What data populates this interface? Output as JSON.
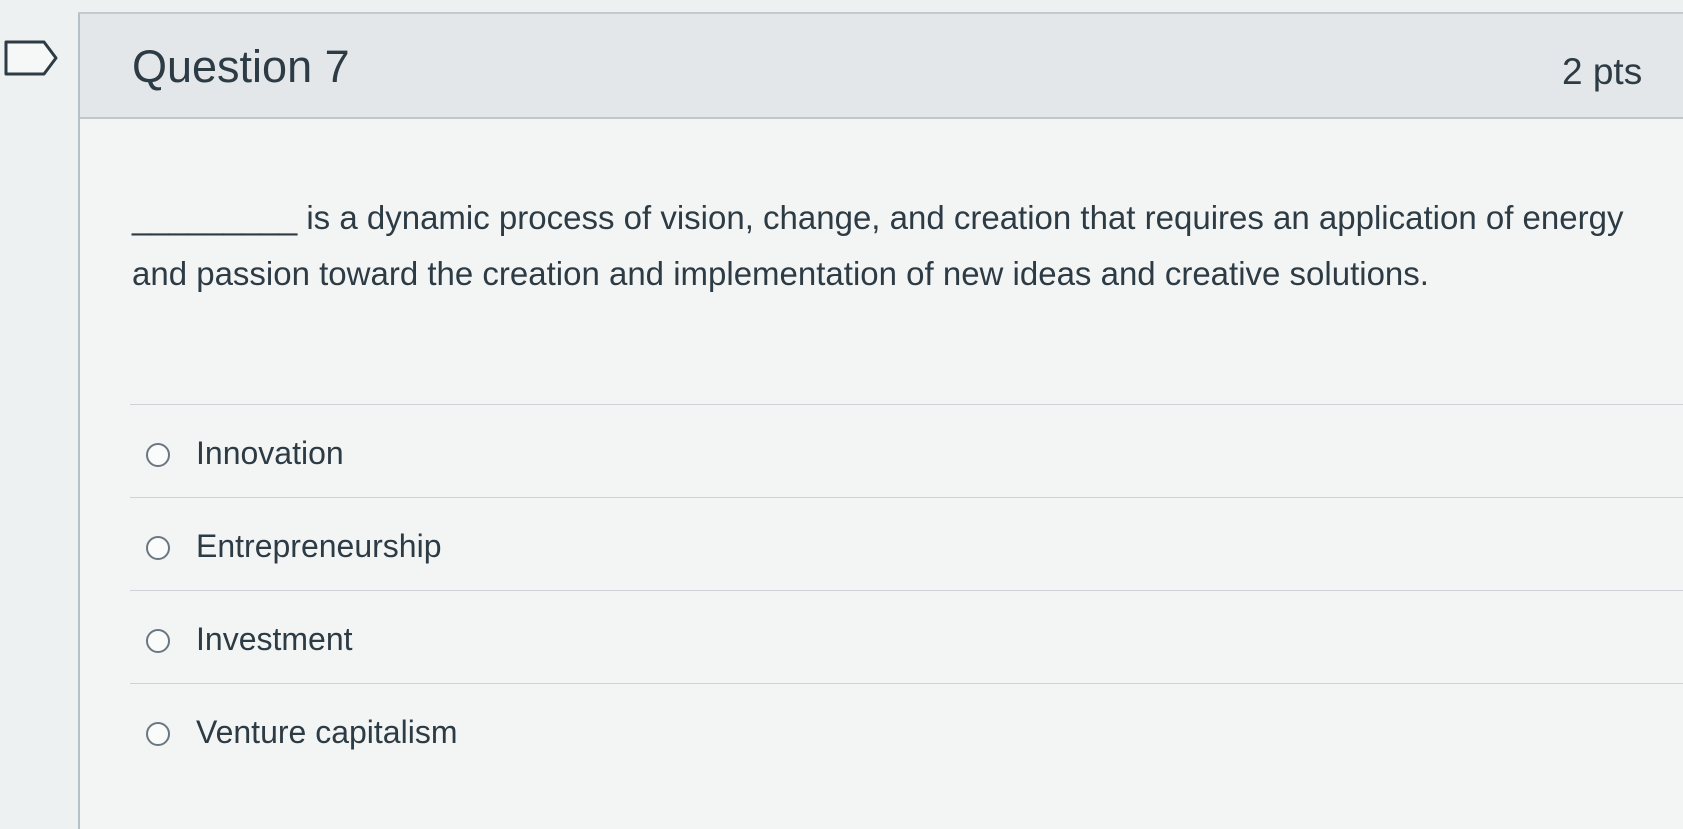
{
  "question": {
    "title": "Question 7",
    "points": "2 pts",
    "text": "_________ is a dynamic process of vision, change, and creation that requires an application of energy and passion toward the creation and implementation of new ideas and creative solutions."
  },
  "answers": [
    {
      "label": "Innovation",
      "selected": false
    },
    {
      "label": "Entrepreneurship",
      "selected": false
    },
    {
      "label": "Investment",
      "selected": false
    },
    {
      "label": "Venture capitalism",
      "selected": false
    }
  ]
}
